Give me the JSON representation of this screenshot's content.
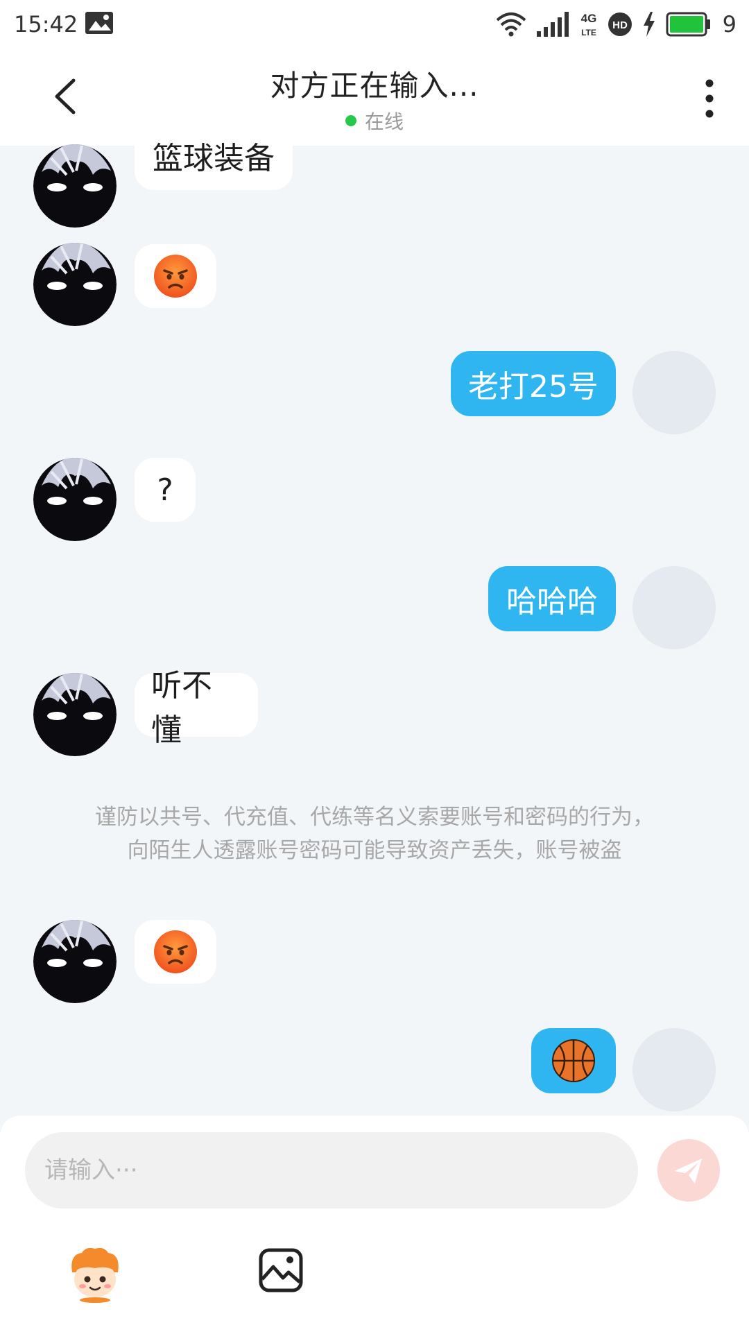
{
  "status_bar": {
    "time": "15:42",
    "battery_level": "9",
    "network": "4G",
    "icons": [
      "gallery-icon",
      "wifi-icon",
      "signal-icon",
      "lte-icon",
      "hd-icon",
      "charging-icon",
      "battery-icon"
    ]
  },
  "header": {
    "title": "对方正在输入...",
    "status_text": "在线",
    "status_color": "#26c94a"
  },
  "messages": [
    {
      "side": "other",
      "text": "篮球装备"
    },
    {
      "side": "other",
      "emoji": "angry-face-icon"
    },
    {
      "side": "me",
      "text": "老打25号"
    },
    {
      "side": "other",
      "text": "?"
    },
    {
      "side": "me",
      "text": "哈哈哈"
    },
    {
      "side": "other",
      "text": "听不懂"
    },
    {
      "side": "other",
      "emoji": "angry-face-icon"
    },
    {
      "side": "me",
      "emoji": "basketball-icon"
    }
  ],
  "notice": {
    "line1": "谨防以共号、代充值、代练等名义索要账号和密码的行为，",
    "line2": "向陌生人透露账号密码可能导致资产丢失，账号被盗"
  },
  "composer": {
    "placeholder": "请输入···",
    "value": ""
  },
  "colors": {
    "accent": "#2fb6f0",
    "background": "#f3f6f9",
    "send_button": "#fbd8d4"
  }
}
